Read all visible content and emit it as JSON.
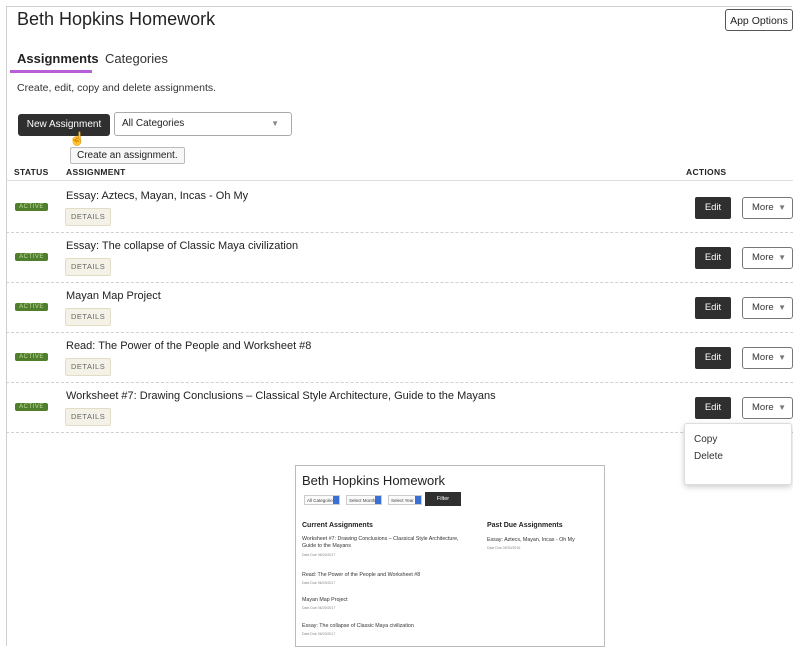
{
  "app": {
    "title": "Beth Hopkins Homework",
    "options_label": "App Options"
  },
  "tabs": [
    {
      "label": "Assignments",
      "active": true
    },
    {
      "label": "Categories",
      "active": false
    }
  ],
  "subtitle": "Create, edit, copy and delete assignments.",
  "toolbar": {
    "new_label": "New Assignment",
    "category_value": "All Categories",
    "tooltip": "Create an assignment."
  },
  "columns": {
    "status": "STATUS",
    "assignment": "ASSIGNMENT",
    "actions": "ACTIONS"
  },
  "rows": [
    {
      "status": "ACTIVE",
      "title": "Essay: Aztecs, Mayan, Incas - Oh My",
      "details": "DETAILS",
      "edit": "Edit",
      "more": "More"
    },
    {
      "status": "ACTIVE",
      "title": "Essay: The collapse of Classic Maya civilization",
      "details": "DETAILS",
      "edit": "Edit",
      "more": "More"
    },
    {
      "status": "ACTIVE",
      "title": "Mayan Map Project",
      "details": "DETAILS",
      "edit": "Edit",
      "more": "More"
    },
    {
      "status": "ACTIVE",
      "title": "Read: The Power of the People and Worksheet #8",
      "details": "DETAILS",
      "edit": "Edit",
      "more": "More"
    },
    {
      "status": "ACTIVE",
      "title": "Worksheet #7: Drawing Conclusions – Classical Style Architecture, Guide to the Mayans",
      "details": "DETAILS",
      "edit": "Edit",
      "more": "More"
    }
  ],
  "more_menu": {
    "copy": "Copy",
    "delete": "Delete"
  },
  "preview": {
    "title": "Beth Hopkins Homework",
    "filters": {
      "category": "All Categories",
      "month": "Select Month",
      "year": "Select Year",
      "filter": "Filter"
    },
    "current_heading": "Current Assignments",
    "past_heading": "Past Due Assignments",
    "current": [
      {
        "title": "Worksheet #7: Drawing Conclusions – Classical Style Architecture, Guide to the Mayans",
        "due": "Date Due 06/29/2017"
      },
      {
        "title": "Read: The Power of the People and Worksheet #8",
        "due": "Date Due 06/29/2017"
      },
      {
        "title": "Mayan Map Project",
        "due": "Date Due 06/29/2017"
      },
      {
        "title": "Essay: The collapse of Classic Maya civilization",
        "due": "Date Due 06/29/2017"
      }
    ],
    "past": [
      {
        "title": "Essay: Aztecs, Mayan, Incas - Oh My",
        "due": "Date Due 09/30/2016"
      }
    ]
  },
  "colors": {
    "accent": "#b65fd6",
    "active_badge": "#4f7f2c",
    "dark_button": "#2f2f2f",
    "filter_blue": "#3a6fd4"
  }
}
